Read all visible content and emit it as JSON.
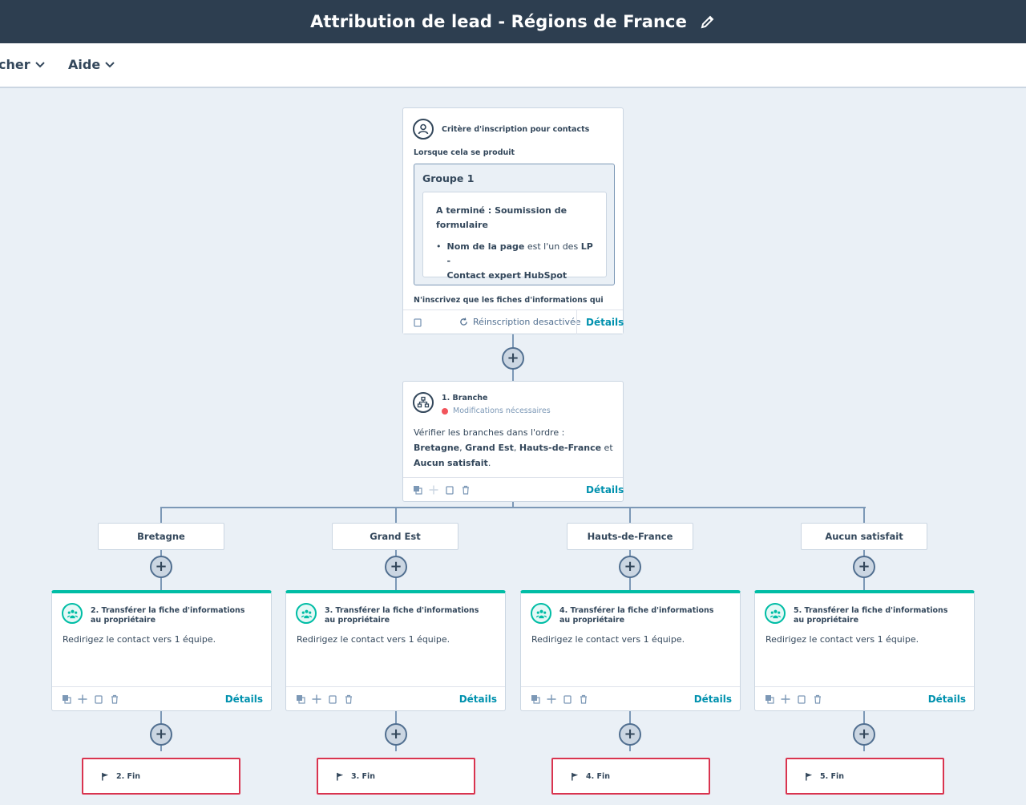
{
  "header": {
    "title": "Attribution de lead - Régions de France"
  },
  "menu": {
    "item1": "cher",
    "item2": "Aide"
  },
  "trigger": {
    "title": "Critère d'inscription pour contacts",
    "when_label": "Lorsque cela se produit",
    "group_title": "Groupe 1",
    "condition_line1": "A terminé : Soumission de",
    "condition_line2": "formulaire",
    "filter_prop": "Nom de la page",
    "filter_op": " est l'un des ",
    "filter_val1": "LP -",
    "filter_val2": "Contact expert HubSpot",
    "note": "N'inscrivez que les fiches d'informations qui",
    "reenroll": "Réinscription desactivée",
    "details": "Détails"
  },
  "branch": {
    "title": "1. Branche",
    "status": "Modifications nécessaires",
    "desc_prefix": "Vérifier les branches dans l'ordre : ",
    "b1": "Bretagne",
    "sep1": ", ",
    "b2": "Grand Est",
    "sep2": ", ",
    "b3": "Hauts-de-France",
    "sep3": " et ",
    "b4": "Aucun",
    "b4b": "satisfait",
    "end": ".",
    "details": "Détails",
    "status_color": "#f2545b"
  },
  "branches": [
    {
      "label": "Bretagne",
      "action_title": "2. Transférer la fiche d'informations au propriétaire",
      "action_desc": "Redirigez le contact vers 1 équipe.",
      "details": "Détails",
      "end": "2. Fin"
    },
    {
      "label": "Grand Est",
      "action_title": "3. Transférer la fiche d'informations au propriétaire",
      "action_desc": "Redirigez le contact vers 1 équipe.",
      "details": "Détails",
      "end": "3. Fin"
    },
    {
      "label": "Hauts-de-France",
      "action_title": "4. Transférer la fiche d'informations au propriétaire",
      "action_desc": "Redirigez le contact vers 1 équipe.",
      "details": "Détails",
      "end": "4. Fin"
    },
    {
      "label": "Aucun satisfait",
      "action_title": "5. Transférer la fiche d'informations au propriétaire",
      "action_desc": "Redirigez le contact vers 1 équipe.",
      "details": "Détails",
      "end": "5. Fin"
    }
  ],
  "colors": {
    "header_bg": "#2d3e50",
    "canvas_bg": "#eaf0f6",
    "accent_teal": "#00bda5",
    "link": "#0091ae",
    "end_border": "#d9344f"
  }
}
